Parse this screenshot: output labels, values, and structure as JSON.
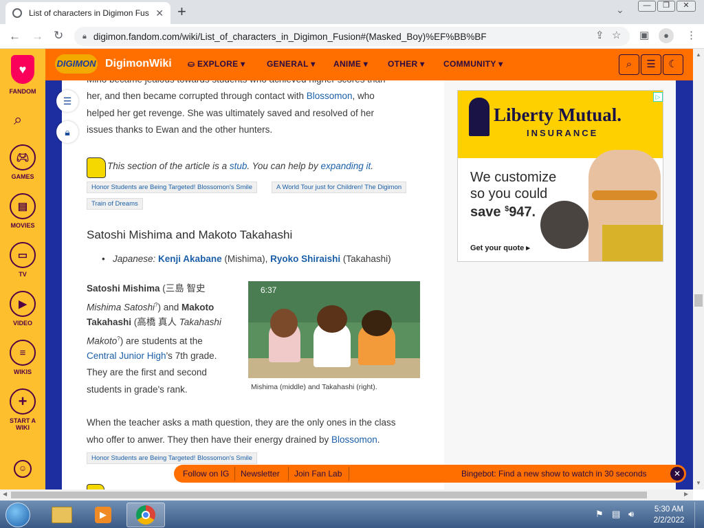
{
  "browser": {
    "tab_title": "List of characters in Digimon Fus",
    "url": "digimon.fandom.com/wiki/List_of_characters_in_Digimon_Fusion#(Masked_Boy)%EF%BB%BF"
  },
  "rail": {
    "fandom": "FANDOM",
    "games": "GAMES",
    "movies": "MOVIES",
    "tv": "TV",
    "video": "VIDEO",
    "wikis": "WIKIS",
    "start_line1": "START A",
    "start_line2": "WIKI"
  },
  "header": {
    "logo": "DIGIMON",
    "site_name": "DigimonWiki",
    "nav": [
      "EXPLORE",
      "GENERAL",
      "ANIME",
      "OTHER",
      "COMMUNITY"
    ]
  },
  "article": {
    "para1_line0": "Mino became jealous towards students who achieved higher scores than",
    "para1_line1_pre": "her, and then became corrupted through contact with ",
    "para1_line1_link": "Blossomon",
    "para1_line1_post": ", who",
    "para1_line2": "helped her get revenge. She was ultimately saved and resolved of her",
    "para1_line3": "issues thanks to Ewan and the other hunters.",
    "stub_pre": "This section of the article is a ",
    "stub_link1": "stub",
    "stub_mid": ". You can help by ",
    "stub_link2": "expanding it",
    "stub_post": ".",
    "cat1": "Honor Students are Being Targeted! Blossomon's Smile",
    "cat2a": "A World Tour just for Children! The Digimon",
    "cat2b": "Train of Dreams",
    "heading": "Satoshi Mishima and Makoto Takahashi",
    "va_label": "Japanese: ",
    "va1": "Kenji Akabane",
    "va1_role": " (Mishima), ",
    "va2": "Ryoko Shiraishi",
    "va2_role": " (Takahashi)",
    "p2_l1a": "Satoshi Mishima",
    "p2_l1b": " (三島 智史",
    "p2_l2a": "Mishima Satoshi",
    "p2_l2b": "?",
    "p2_l2c": ") and ",
    "p2_l2d": "Makoto",
    "p2_l3a": "Takahashi",
    "p2_l3b": " (高橋 真人 ",
    "p2_l3c": "Takahashi",
    "p2_l4a": "Makoto",
    "p2_l4b": "?",
    "p2_l4c": ") are students at the",
    "p2_l5a": "Central Junior High",
    "p2_l5b": "'s 7th grade.",
    "p2_l6": "They are the first and second",
    "p2_l7": "students in grade's rank.",
    "image_timestamp": "6:37",
    "caption": "Mishima (middle) and Takahashi (right).",
    "p3_l1": "When the teacher asks a math question, they are the only ones in the class",
    "p3_l2_pre": "who offer to anwer. They then have their energy drained by ",
    "p3_l2_link": "Blossomon",
    "p3_l2_post": ".",
    "cat3": "Honor Students are Being Targeted! Blossomon's Smile"
  },
  "ad": {
    "brand": "Liberty Mutual.",
    "brand_sub": "INSURANCE",
    "line1": "We customize",
    "line2": "so you could",
    "line3_pre": "save ",
    "line3_sup": "$",
    "line3_amount": "947.",
    "cta": "Get your quote ▸"
  },
  "bottombar": {
    "follow": "Follow on IG",
    "newsletter": "Newsletter",
    "fanlab": "Join Fan Lab",
    "bingebot": "Bingebot: Find a new show to watch in 30 seconds"
  },
  "taskbar": {
    "time": "5:30 AM",
    "date": "2/2/2022"
  },
  "colors": {
    "fandom_orange": "#ff6f00",
    "rail_yellow": "#fdbf2d",
    "link_blue": "#1b5fa8",
    "page_blue": "#1d2fa0"
  }
}
